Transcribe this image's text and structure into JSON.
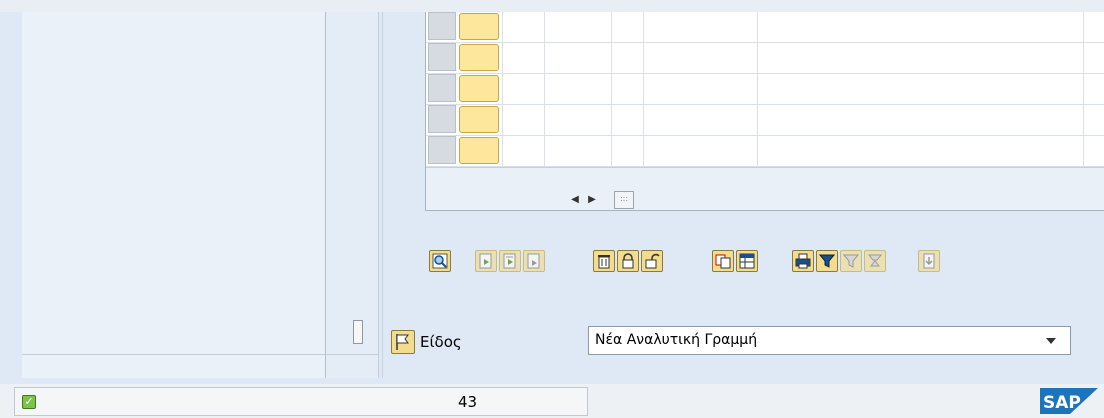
{
  "type_field": {
    "label": "Είδος",
    "value": "Νέα Αναλυτική Γραμμή"
  },
  "status_bar": {
    "count": "43"
  },
  "logo": {
    "text": "SAP"
  },
  "grid": {
    "visible_rows": 5
  },
  "toolbar": {
    "icons": [
      "find-icon",
      "insert-row-icon",
      "append-row-icon",
      "copy-row-icon",
      "delete-icon",
      "lock-icon",
      "unlock-icon",
      "copy-icon",
      "layout-icon",
      "print-icon",
      "filter-icon",
      "filter-disabled-icon",
      "sort-icon",
      "export-icon"
    ]
  },
  "colors": {
    "row_button": "#fde79c",
    "background": "#dfe9f5",
    "sap_blue": "#1c75bc"
  }
}
